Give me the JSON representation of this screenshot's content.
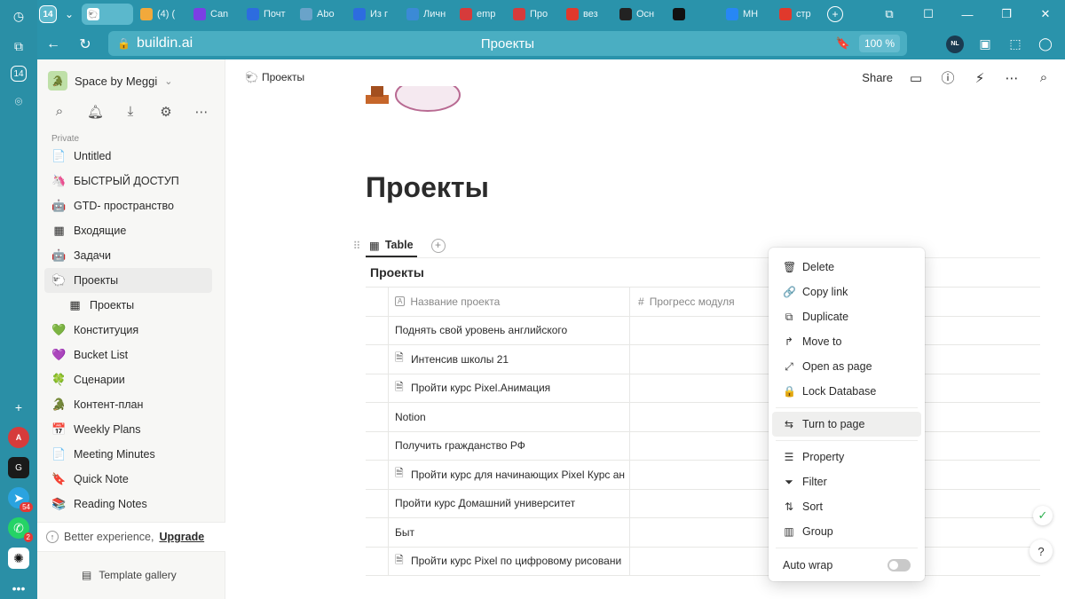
{
  "browser": {
    "tab_count": "14",
    "tabs": [
      {
        "label": "(4) (",
        "color": "#f2a93b",
        "icon": "clapper-icon"
      },
      {
        "label": "Can",
        "color": "#7b3fe4",
        "icon": "canva-icon"
      },
      {
        "label": "Почт",
        "color": "#2d6cdf",
        "icon": "mail-icon"
      },
      {
        "label": "Abo",
        "color": "#6aa3c9",
        "icon": "chart-icon"
      },
      {
        "label": "Из г",
        "color": "#2d6cdf",
        "icon": "browser-icon"
      },
      {
        "label": "Личн",
        "color": "#3b8ad6",
        "icon": "globe-icon"
      },
      {
        "label": "emp",
        "color": "#d63b3b",
        "icon": "ae-icon"
      },
      {
        "label": "Про",
        "color": "#d63b3b",
        "icon": "ae-icon"
      },
      {
        "label": "вез",
        "color": "#e0392c",
        "icon": "yandex-icon"
      },
      {
        "label": "Осн",
        "color": "#222222",
        "icon": "notion-icon"
      },
      {
        "label": "",
        "color": "#111111",
        "icon": "d-icon"
      },
      {
        "label": "МН",
        "color": "#2787f5",
        "icon": "vk-icon"
      },
      {
        "label": "стр",
        "color": "#e0392c",
        "icon": "yandex-icon"
      }
    ],
    "domain": "buildin.ai",
    "page_title": "Проекты",
    "zoom": "100 %",
    "nl_badge": "NL"
  },
  "os": {
    "telegram_badge": "54",
    "whatsapp_badge": "2"
  },
  "sidebar": {
    "space_name": "Space by Meggi",
    "section": "Private",
    "items": [
      {
        "label": "Untitled",
        "icon": "📄",
        "sub": false
      },
      {
        "label": "БЫСТРЫЙ ДОСТУП",
        "icon": "🦄",
        "sub": false
      },
      {
        "label": "GTD- пространство",
        "icon": "🤖",
        "sub": false
      },
      {
        "label": "Входящие",
        "icon": "▦",
        "sub": false
      },
      {
        "label": "Задачи",
        "icon": "🤖",
        "sub": false
      },
      {
        "label": "Проекты",
        "icon": "🐑",
        "sub": false,
        "active": true
      },
      {
        "label": "Проекты",
        "icon": "▦",
        "sub": true
      },
      {
        "label": "Конституция",
        "icon": "💚",
        "sub": false
      },
      {
        "label": "Bucket List",
        "icon": "💜",
        "sub": false
      },
      {
        "label": "Сценарии",
        "icon": "🍀",
        "sub": false
      },
      {
        "label": "Контент-план",
        "icon": "🐊",
        "sub": false
      },
      {
        "label": "Weekly Plans",
        "icon": "📅",
        "sub": false
      },
      {
        "label": "Meeting Minutes",
        "icon": "📄",
        "sub": false
      },
      {
        "label": "Quick Note",
        "icon": "🔖",
        "sub": false
      },
      {
        "label": "Reading Notes",
        "icon": "📚",
        "sub": false
      }
    ],
    "upgrade_prefix": "Better experience,",
    "upgrade_link": "Upgrade",
    "template_gallery": "Template gallery"
  },
  "topbar": {
    "breadcrumb": "Проекты",
    "share": "Share"
  },
  "page": {
    "title": "Проекты",
    "view_tab": "Table",
    "db_title": "Проекты",
    "columns": [
      "Название проекта",
      "Прогресс модуля"
    ],
    "rows": [
      {
        "name": "Поднять свой уровень английского",
        "doc": false
      },
      {
        "name": "Интенсив школы 21",
        "doc": true
      },
      {
        "name": "Пройти курс Pixel.Анимация",
        "doc": true
      },
      {
        "name": "Notion",
        "doc": false
      },
      {
        "name": "Получить гражданство РФ",
        "doc": false
      },
      {
        "name": "Пройти курс для начинающих Pixel Курс ан",
        "doc": true
      },
      {
        "name": "Пройти курс Домашний университет",
        "doc": false
      },
      {
        "name": "Быт",
        "doc": false
      },
      {
        "name": "Пройти курс Pixel по цифровому рисовани",
        "doc": true
      }
    ]
  },
  "menu": {
    "group1": [
      {
        "label": "Delete",
        "icon": "🗑"
      },
      {
        "label": "Copy link",
        "icon": "🔗"
      },
      {
        "label": "Duplicate",
        "icon": "⧉"
      },
      {
        "label": "Move to",
        "icon": "↱"
      },
      {
        "label": "Open as page",
        "icon": "⤢"
      },
      {
        "label": "Lock Database",
        "icon": "🔒"
      }
    ],
    "turn_to_page": "Turn to page",
    "group2": [
      {
        "label": "Property",
        "icon": "☰"
      },
      {
        "label": "Filter",
        "icon": "⏷"
      },
      {
        "label": "Sort",
        "icon": "⇅"
      },
      {
        "label": "Group",
        "icon": "▥"
      }
    ],
    "auto_wrap": "Auto wrap"
  }
}
